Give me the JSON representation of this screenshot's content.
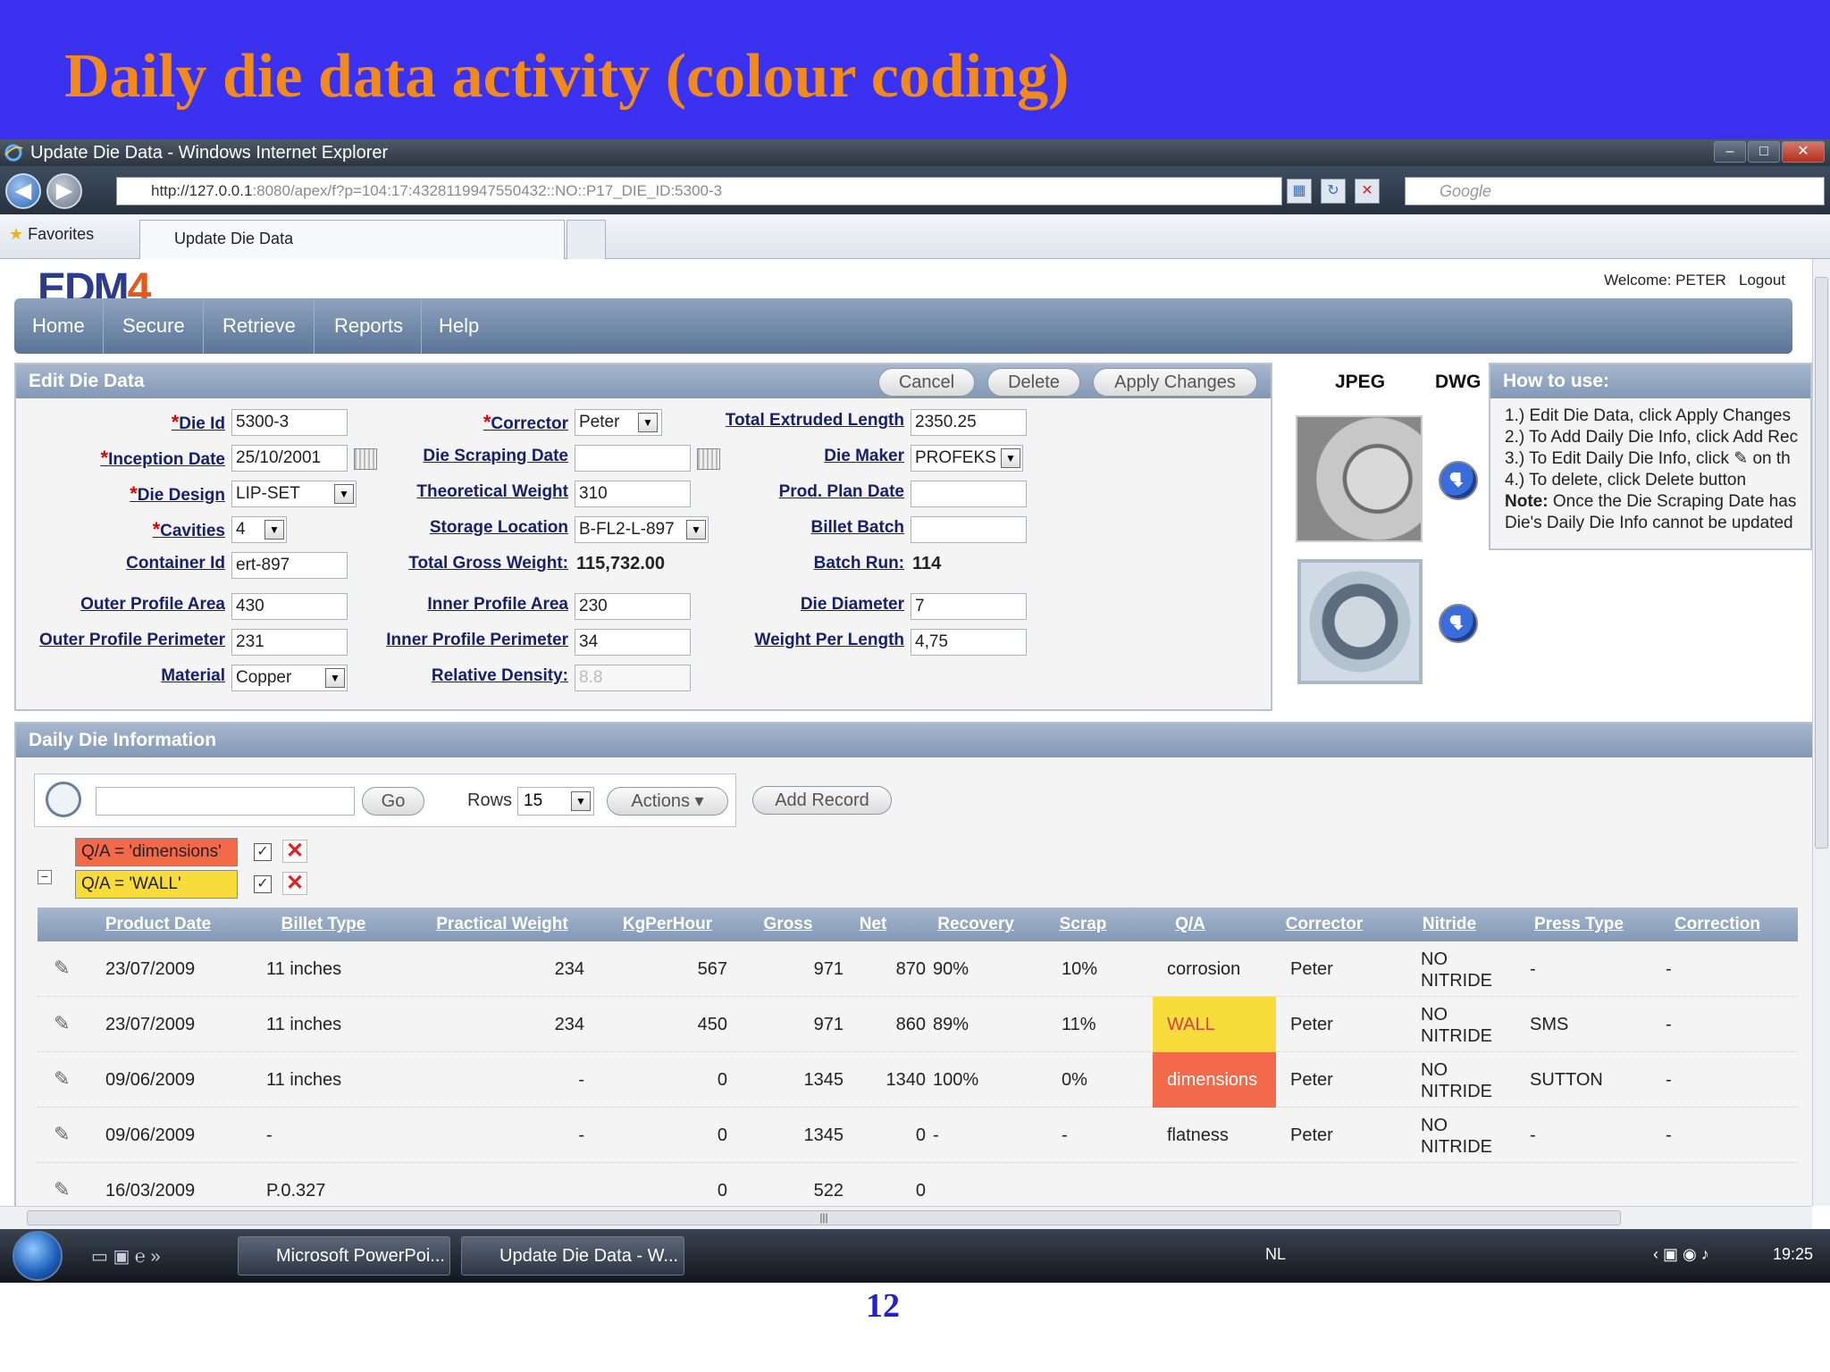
{
  "slide": {
    "title": "Daily die data activity (colour coding)",
    "page_number": "12"
  },
  "browser": {
    "window_title": "Update Die Data - Windows Internet Explorer",
    "url_host": "http://127.0.0.1",
    "url_rest": ":8080/apex/f?p=104:17:4328119947550432::NO::P17_DIE_ID:5300-3",
    "search_placeholder": "Google",
    "favorites_label": "Favorites",
    "tab_label": "Update Die Data"
  },
  "app": {
    "logo_main": "EDM",
    "logo_accent": "4",
    "welcome": "Welcome: PETER",
    "logout": "Logout",
    "nav": [
      "Home",
      "Secure",
      "Retrieve",
      "Reports",
      "Help"
    ]
  },
  "edit_panel": {
    "title": "Edit Die Data",
    "buttons": {
      "cancel": "Cancel",
      "delete": "Delete",
      "apply": "Apply Changes"
    },
    "fields": {
      "die_id": {
        "label": "Die Id",
        "value": "5300-3"
      },
      "inception_date": {
        "label": "Inception Date",
        "value": "25/10/2001"
      },
      "die_design": {
        "label": "Die Design",
        "value": "LIP-SET"
      },
      "cavities": {
        "label": "Cavities",
        "value": "4"
      },
      "container_id": {
        "label": "Container Id",
        "value": "ert-897"
      },
      "outer_profile_area": {
        "label": "Outer Profile Area",
        "value": "430"
      },
      "outer_profile_perimeter": {
        "label": "Outer Profile Perimeter",
        "value": "231"
      },
      "material": {
        "label": "Material",
        "value": "Copper"
      },
      "corrector": {
        "label": "Corrector",
        "value": "Peter"
      },
      "die_scraping_date": {
        "label": "Die Scraping Date",
        "value": ""
      },
      "theoretical_weight": {
        "label": "Theoretical Weight",
        "value": "310"
      },
      "storage_location": {
        "label": "Storage Location",
        "value": "B-FL2-L-897"
      },
      "total_gross_weight": {
        "label": "Total Gross Weight:",
        "value": "115,732.00"
      },
      "inner_profile_area": {
        "label": "Inner Profile Area",
        "value": "230"
      },
      "inner_profile_perimeter": {
        "label": "Inner Profile Perimeter",
        "value": "34"
      },
      "relative_density": {
        "label": "Relative Density:",
        "value": "8.8"
      },
      "total_extruded_length": {
        "label": "Total Extruded Length",
        "value": "2350.25"
      },
      "die_maker": {
        "label": "Die Maker",
        "value": "PROFEKS"
      },
      "prod_plan_date": {
        "label": "Prod. Plan Date",
        "value": ""
      },
      "billet_batch": {
        "label": "Billet Batch",
        "value": ""
      },
      "batch_run": {
        "label": "Batch Run:",
        "value": "114"
      },
      "die_diameter": {
        "label": "Die Diameter",
        "value": "7"
      },
      "weight_per_length": {
        "label": "Weight Per Length",
        "value": "4,75"
      }
    }
  },
  "images": {
    "jpeg_label": "JPEG",
    "dwg_label": "DWG"
  },
  "howto": {
    "title": "How to use:",
    "lines": [
      "1.) Edit Die Data, click Apply Changes",
      "2.) To Add Daily Die Info, click Add Rec",
      "3.) To Edit Daily Die Info, click",
      "on th",
      "4.) To delete, click Delete button",
      "Note:",
      "Once the Die Scraping Date has",
      "Die's Daily Die Info cannot be updated"
    ]
  },
  "daily": {
    "title": "Daily Die Information",
    "go": "Go",
    "rows_label": "Rows",
    "rows_value": "15",
    "actions": "Actions",
    "add_record": "Add Record",
    "filters": [
      "Q/A = 'dimensions'",
      "Q/A = 'WALL'"
    ],
    "colors": {
      "dimensions": "#f36a4a",
      "wall": "#f8dc3c"
    },
    "columns": [
      "Product Date",
      "Billet Type",
      "Practical Weight",
      "KgPerHour",
      "Gross",
      "Net",
      "Recovery",
      "Scrap",
      "Q/A",
      "Corrector",
      "Nitride",
      "Press Type",
      "Correction"
    ],
    "rows": [
      {
        "date": "23/07/2009",
        "billet": "11 inches",
        "pw": "234",
        "kph": "567",
        "gross": "971",
        "net": "870",
        "rec": "90%",
        "scrap": "10%",
        "qa": "corrosion",
        "corr": "Peter",
        "nit1": "NO",
        "nit2": "NITRIDE",
        "press": "-",
        "correction": "-"
      },
      {
        "date": "23/07/2009",
        "billet": "11 inches",
        "pw": "234",
        "kph": "450",
        "gross": "971",
        "net": "860",
        "rec": "89%",
        "scrap": "11%",
        "qa": "WALL",
        "corr": "Peter",
        "nit1": "NO",
        "nit2": "NITRIDE",
        "press": "SMS",
        "correction": "-"
      },
      {
        "date": "09/06/2009",
        "billet": "11 inches",
        "pw": "-",
        "kph": "0",
        "gross": "1345",
        "net": "1340",
        "rec": "100%",
        "scrap": "0%",
        "qa": "dimensions",
        "corr": "Peter",
        "nit1": "NO",
        "nit2": "NITRIDE",
        "press": "SUTTON",
        "correction": "-"
      },
      {
        "date": "09/06/2009",
        "billet": "-",
        "pw": "-",
        "kph": "0",
        "gross": "1345",
        "net": "0",
        "rec": "-",
        "scrap": "-",
        "qa": "flatness",
        "corr": "Peter",
        "nit1": "NO",
        "nit2": "NITRIDE",
        "press": "-",
        "correction": "-"
      },
      {
        "date": "16/03/2009",
        "billet": "P.0.327",
        "pw": "",
        "kph": "0",
        "gross": "522",
        "net": "0",
        "rec": "",
        "scrap": "",
        "qa": "",
        "corr": "",
        "nit1": "",
        "nit2": "",
        "press": "",
        "correction": ""
      }
    ]
  },
  "taskbar": {
    "items": [
      "Microsoft PowerPoi...",
      "Update Die Data - W..."
    ],
    "lang": "NL",
    "time": "19:25"
  }
}
